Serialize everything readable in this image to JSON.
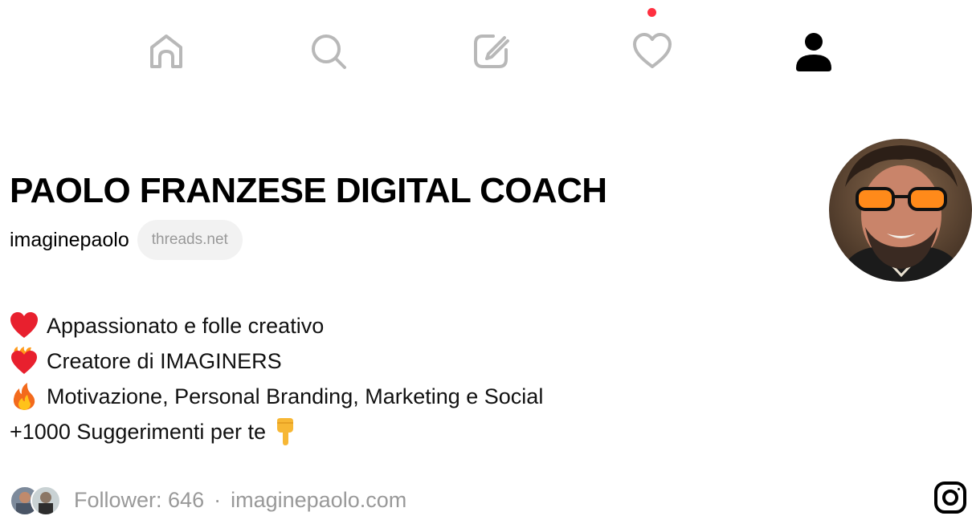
{
  "nav": {
    "items": [
      {
        "icon": "home-icon",
        "active": false
      },
      {
        "icon": "search-icon",
        "active": false
      },
      {
        "icon": "compose-icon",
        "active": false
      },
      {
        "icon": "heart-icon",
        "active": false,
        "has_notification": true
      },
      {
        "icon": "profile-icon",
        "active": true
      }
    ],
    "inactive_color": "#b8b8b8",
    "active_color": "#000000",
    "notification_color": "#ff3040"
  },
  "profile": {
    "display_name": "PAOLO FRANZESE DIGITAL COACH",
    "username": "imaginepaolo",
    "domain_badge": "threads.net",
    "bio": [
      {
        "emoji": "red-heart",
        "text": "Appassionato e folle creativo"
      },
      {
        "emoji": "heart-on-fire",
        "text": "Creatore di IMAGINERS"
      },
      {
        "emoji": "fire",
        "text": "Motivazione, Personal Branding, Marketing e Social"
      },
      {
        "emoji": "",
        "text": "+1000 Suggerimenti per te",
        "trailing_emoji": "backhand-index-pointing-down"
      }
    ],
    "followers_text": "Follower: 646",
    "separator": "·",
    "link": "imaginepaolo.com",
    "social_icon": "instagram-icon"
  }
}
